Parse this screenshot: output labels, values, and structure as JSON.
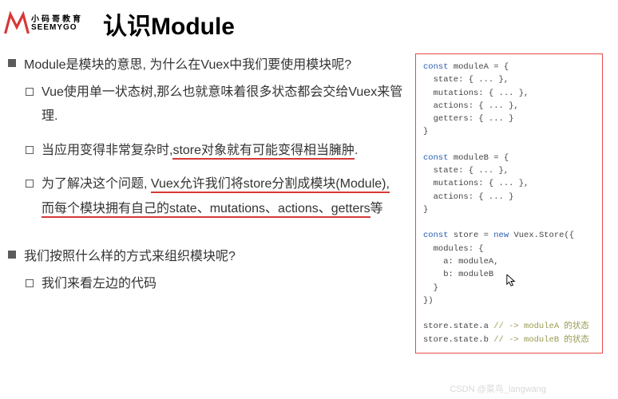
{
  "logo": {
    "cn": "小码哥教育",
    "en": "SEEMYGO"
  },
  "title": "认识Module",
  "section1": {
    "heading": "Module是模块的意思, 为什么在Vuex中我们要使用模块呢?",
    "item1": "Vue使用单一状态树,那么也就意味着很多状态都会交给Vuex来管理.",
    "item2_a": "当应用变得非常复杂时,",
    "item2_b": "store对象就有可能变得相当臃肿",
    "item2_c": ".",
    "item3_a": "为了解决这个问题, ",
    "item3_b": "Vuex允许我们将store分割成模块(Module), 而每个模块拥有自己的state、mutations、actions、getters",
    "item3_c": "等"
  },
  "section2": {
    "heading": "我们按照什么样的方式来组织模块呢?",
    "item1": "我们来看左边的代码"
  },
  "code": {
    "l01a": "const",
    "l01b": " moduleA = {",
    "l02": "  state: { ... },",
    "l03": "  mutations: { ... },",
    "l04": "  actions: { ... },",
    "l05": "  getters: { ... }",
    "l06": "}",
    "l07": "",
    "l08a": "const",
    "l08b": " moduleB = {",
    "l09": "  state: { ... },",
    "l10": "  mutations: { ... },",
    "l11": "  actions: { ... }",
    "l12": "}",
    "l13": "",
    "l14a": "const",
    "l14b": " store = ",
    "l14c": "new",
    "l14d": " Vuex.Store({",
    "l15": "  modules: {",
    "l16": "    a: moduleA,",
    "l17": "    b: moduleB",
    "l18": "  }",
    "l19": "})",
    "l20": "",
    "l21a": "store.state.a ",
    "l21b": "// -> moduleA 的状态",
    "l22a": "store.state.b ",
    "l22b": "// -> moduleB 的状态"
  },
  "watermark": "CSDN @菜鸟_langwang"
}
